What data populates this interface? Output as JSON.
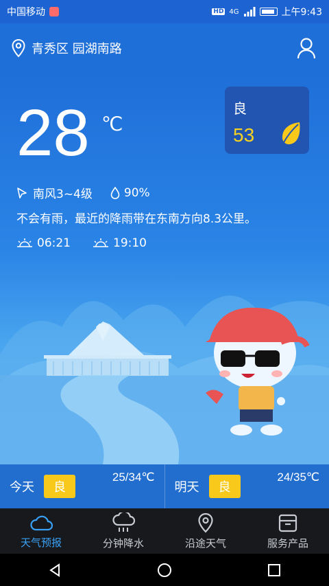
{
  "status_bar": {
    "carrier": "中国移动",
    "network": "4G",
    "hd": "HD",
    "time": "上午9:43"
  },
  "location": {
    "address": "青秀区 园湖南路",
    "icon": "location-pin-icon",
    "user_icon": "user-icon"
  },
  "weather": {
    "temperature": "28",
    "unit": "℃",
    "wind": "南风3~4级",
    "humidity": "90%",
    "description": "不会有雨，最近的降雨带在东南方向8.3公里。",
    "sunrise": "06:21",
    "sunset": "19:10"
  },
  "aqi": {
    "level": "良",
    "value": "53",
    "color": "#f8d21e"
  },
  "forecast": [
    {
      "day": "今天",
      "quality": "良",
      "range": "25/34℃"
    },
    {
      "day": "明天",
      "quality": "良",
      "range": "24/35℃"
    }
  ],
  "tabs": [
    {
      "label": "天气预报",
      "icon": "cloud-icon",
      "active": true
    },
    {
      "label": "分钟降水",
      "icon": "rain-cloud-icon",
      "active": false
    },
    {
      "label": "沿途天气",
      "icon": "location-pin-icon",
      "active": false
    },
    {
      "label": "服务产品",
      "icon": "box-icon",
      "active": false
    }
  ],
  "colors": {
    "primary": "#1f6fd8",
    "badge": "#f8c91a",
    "active_tab": "#3aa0f5",
    "tabbar": "#17191d"
  }
}
